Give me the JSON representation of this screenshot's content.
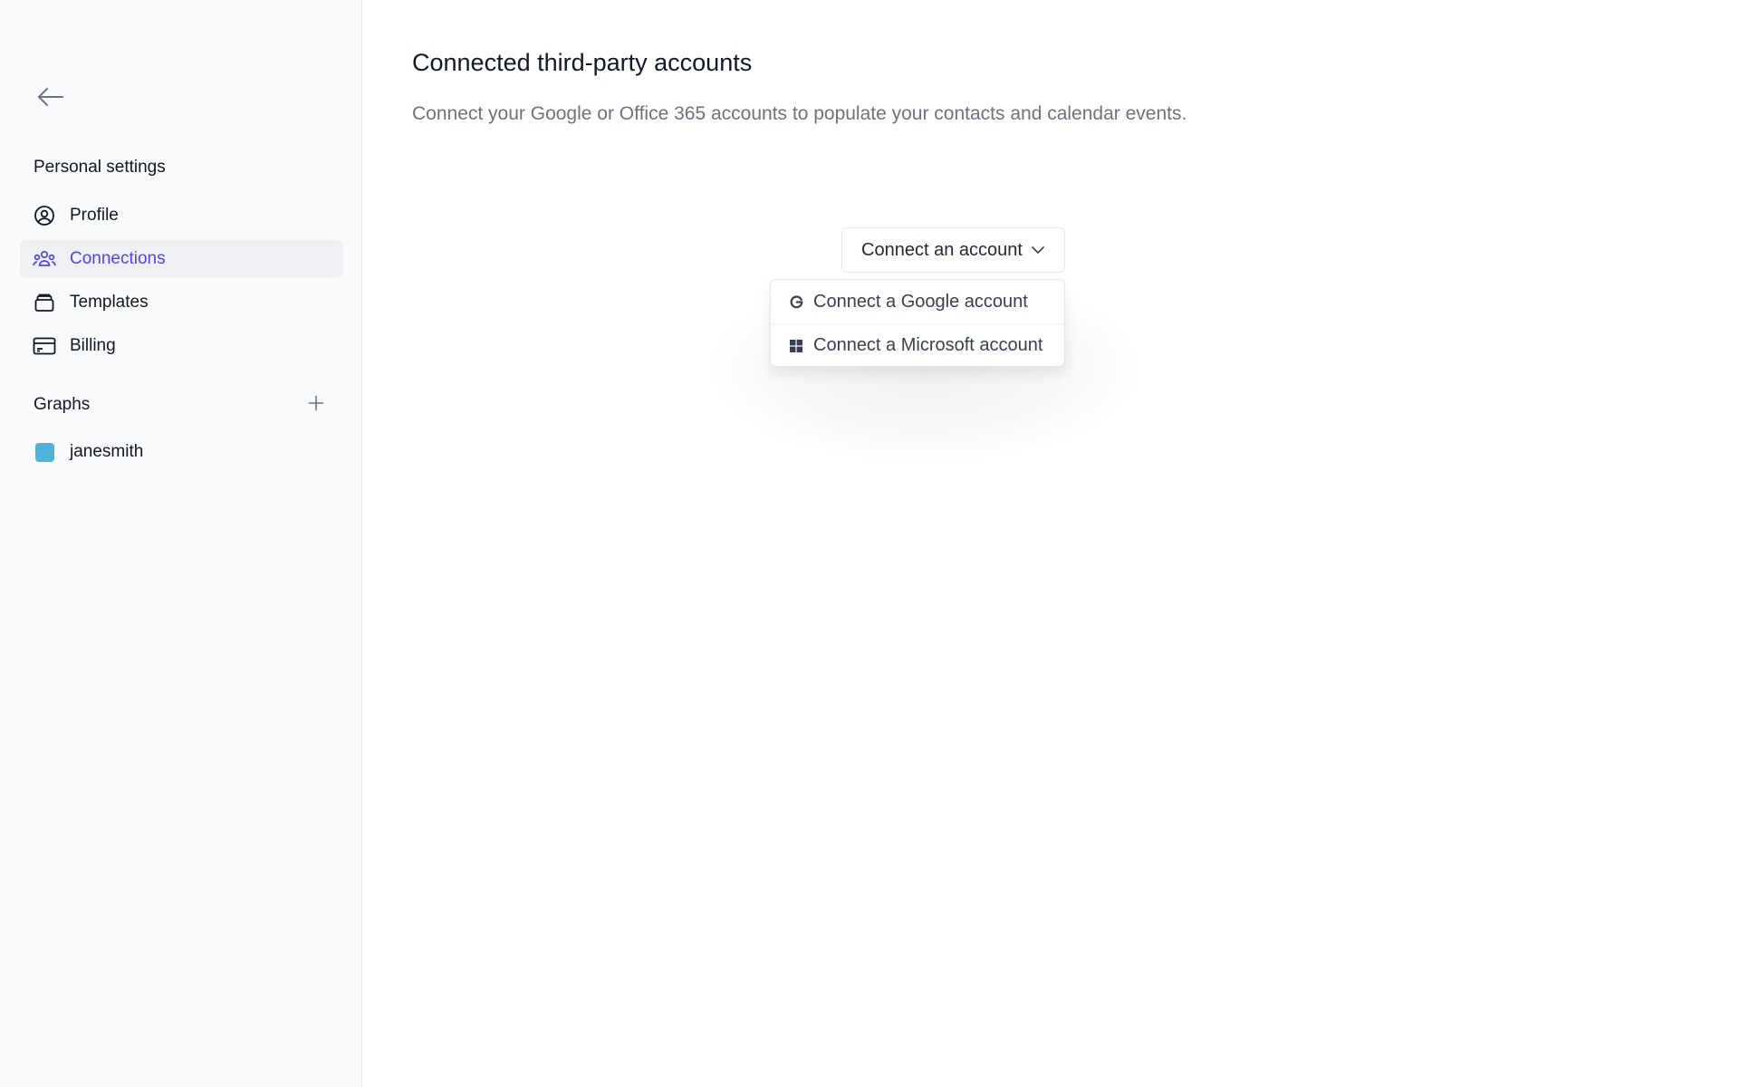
{
  "sidebar": {
    "back_icon": "arrow-left-icon",
    "personal_heading": "Personal settings",
    "items": [
      {
        "label": "Profile",
        "icon": "user-circle-icon",
        "active": false
      },
      {
        "label": "Connections",
        "icon": "users-icon",
        "active": true
      },
      {
        "label": "Templates",
        "icon": "stack-icon",
        "active": false
      },
      {
        "label": "Billing",
        "icon": "credit-card-icon",
        "active": false
      }
    ],
    "graphs_heading": "Graphs",
    "add_icon": "plus-icon",
    "graphs": [
      {
        "label": "janesmith",
        "color": "#4fb3d9"
      }
    ]
  },
  "main": {
    "title": "Connected third-party accounts",
    "subtitle": "Connect your Google or Office 365 accounts to populate your contacts and calendar events.",
    "connect_button": {
      "label": "Connect an account",
      "icon": "chevron-down-icon"
    },
    "dropdown": {
      "items": [
        {
          "label": "Connect a Google account",
          "icon": "google-icon"
        },
        {
          "label": "Connect a Microsoft account",
          "icon": "windows-icon"
        }
      ]
    }
  },
  "colors": {
    "accent": "#4f46e5",
    "sidebar_bg": "#f9fafb",
    "active_bg": "#eff0f3"
  }
}
